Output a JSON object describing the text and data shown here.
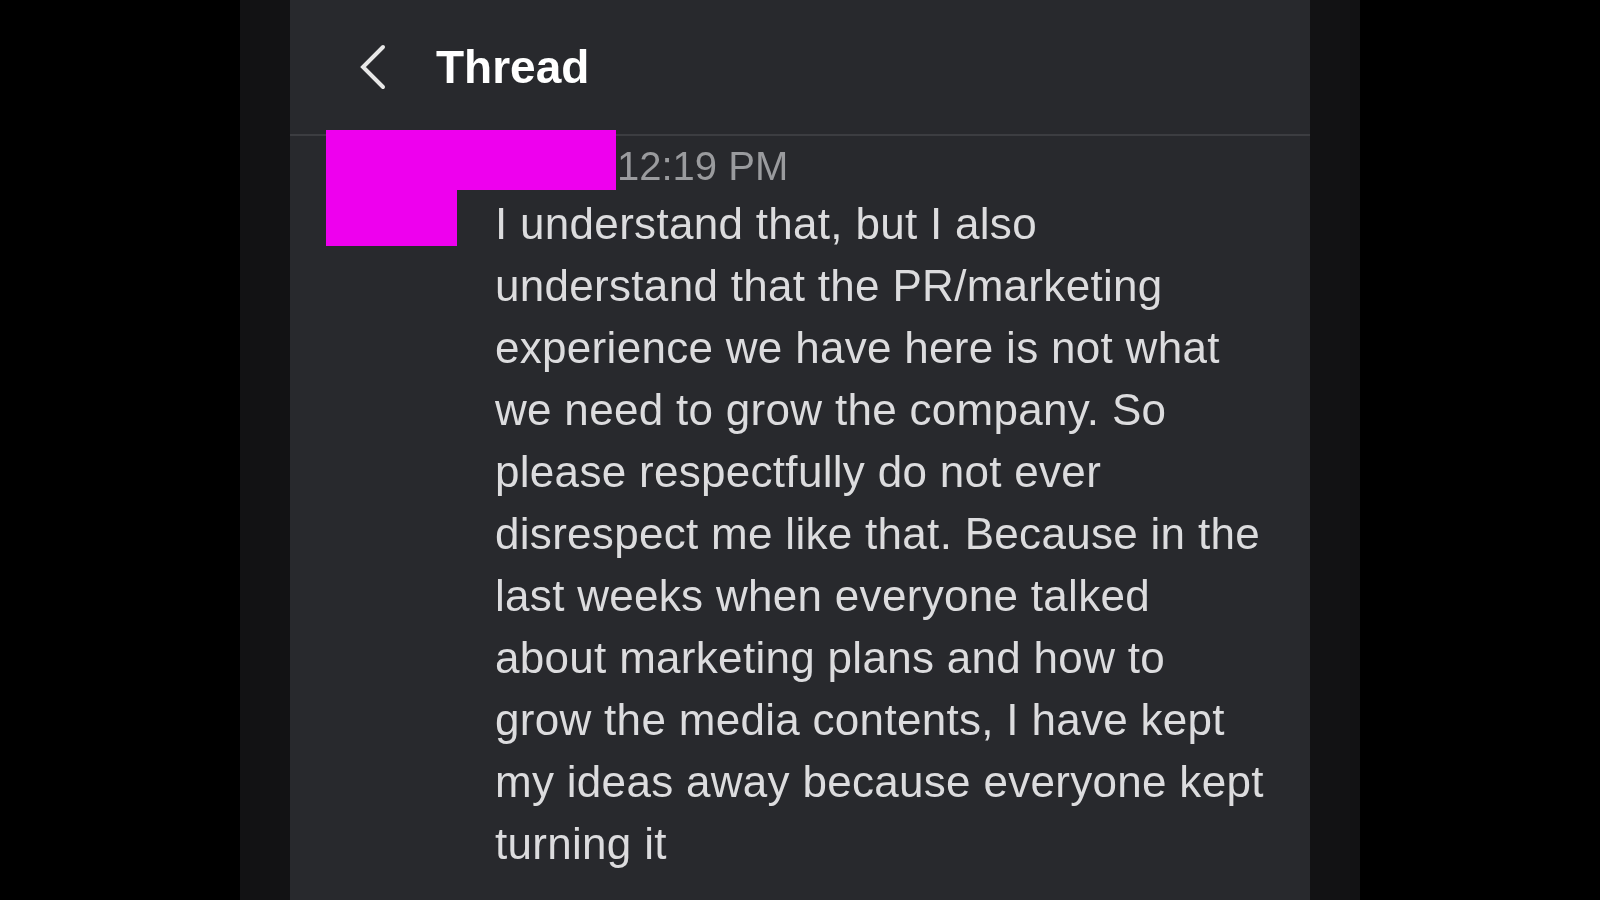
{
  "header": {
    "title": "Thread"
  },
  "message": {
    "time": "12:19 PM",
    "text": "I understand that, but I also understand that the PR/marketing experience we have here is not what we need to grow the company. So please respectfully do not ever disrespect me like that. Because in the last weeks when everyone talked about marketing plans and how to grow the media contents, I have kept my ideas away because everyone kept turning it",
    "redacted": true
  }
}
